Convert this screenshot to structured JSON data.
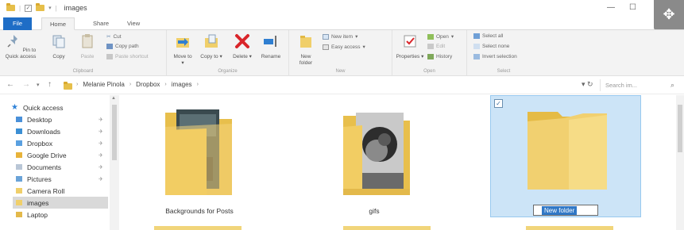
{
  "window": {
    "title": "images"
  },
  "tabs": [
    {
      "label": "File"
    },
    {
      "label": "Home"
    },
    {
      "label": "Share"
    },
    {
      "label": "View"
    }
  ],
  "ribbon": {
    "clipboard": {
      "label": "Clipboard",
      "pin": "Pin to Quick access",
      "copy": "Copy",
      "paste": "Paste",
      "cut": "Cut",
      "copy_path": "Copy path",
      "paste_shortcut": "Paste shortcut"
    },
    "organize": {
      "label": "Organize",
      "move_to": "Move to",
      "copy_to": "Copy to",
      "delete": "Delete",
      "rename": "Rename"
    },
    "new": {
      "label": "New",
      "new_folder": "New folder",
      "new_item": "New item",
      "easy_access": "Easy access"
    },
    "open": {
      "label": "Open",
      "properties": "Properties",
      "open": "Open",
      "edit": "Edit",
      "history": "History"
    },
    "select": {
      "label": "Select",
      "select_all": "Select all",
      "select_none": "Select none",
      "invert": "Invert selection"
    }
  },
  "address": {
    "crumbs": [
      "Melanie Pinola",
      "Dropbox",
      "images"
    ],
    "search_placeholder": "Search im..."
  },
  "nav": {
    "quick_access": "Quick access",
    "items": [
      {
        "label": "Desktop"
      },
      {
        "label": "Downloads"
      },
      {
        "label": "Dropbox"
      },
      {
        "label": "Google Drive"
      },
      {
        "label": "Documents"
      },
      {
        "label": "Pictures"
      },
      {
        "label": "Camera Roll"
      },
      {
        "label": "images"
      },
      {
        "label": "Laptop"
      }
    ]
  },
  "content": {
    "tiles": [
      {
        "label": "Backgrounds for Posts"
      },
      {
        "label": "gifs"
      }
    ],
    "new_folder_name": "New folder"
  },
  "colors": {
    "accent": "#1e6dc6",
    "folder": "#f0cf6a",
    "selection": "#cce4f7"
  }
}
